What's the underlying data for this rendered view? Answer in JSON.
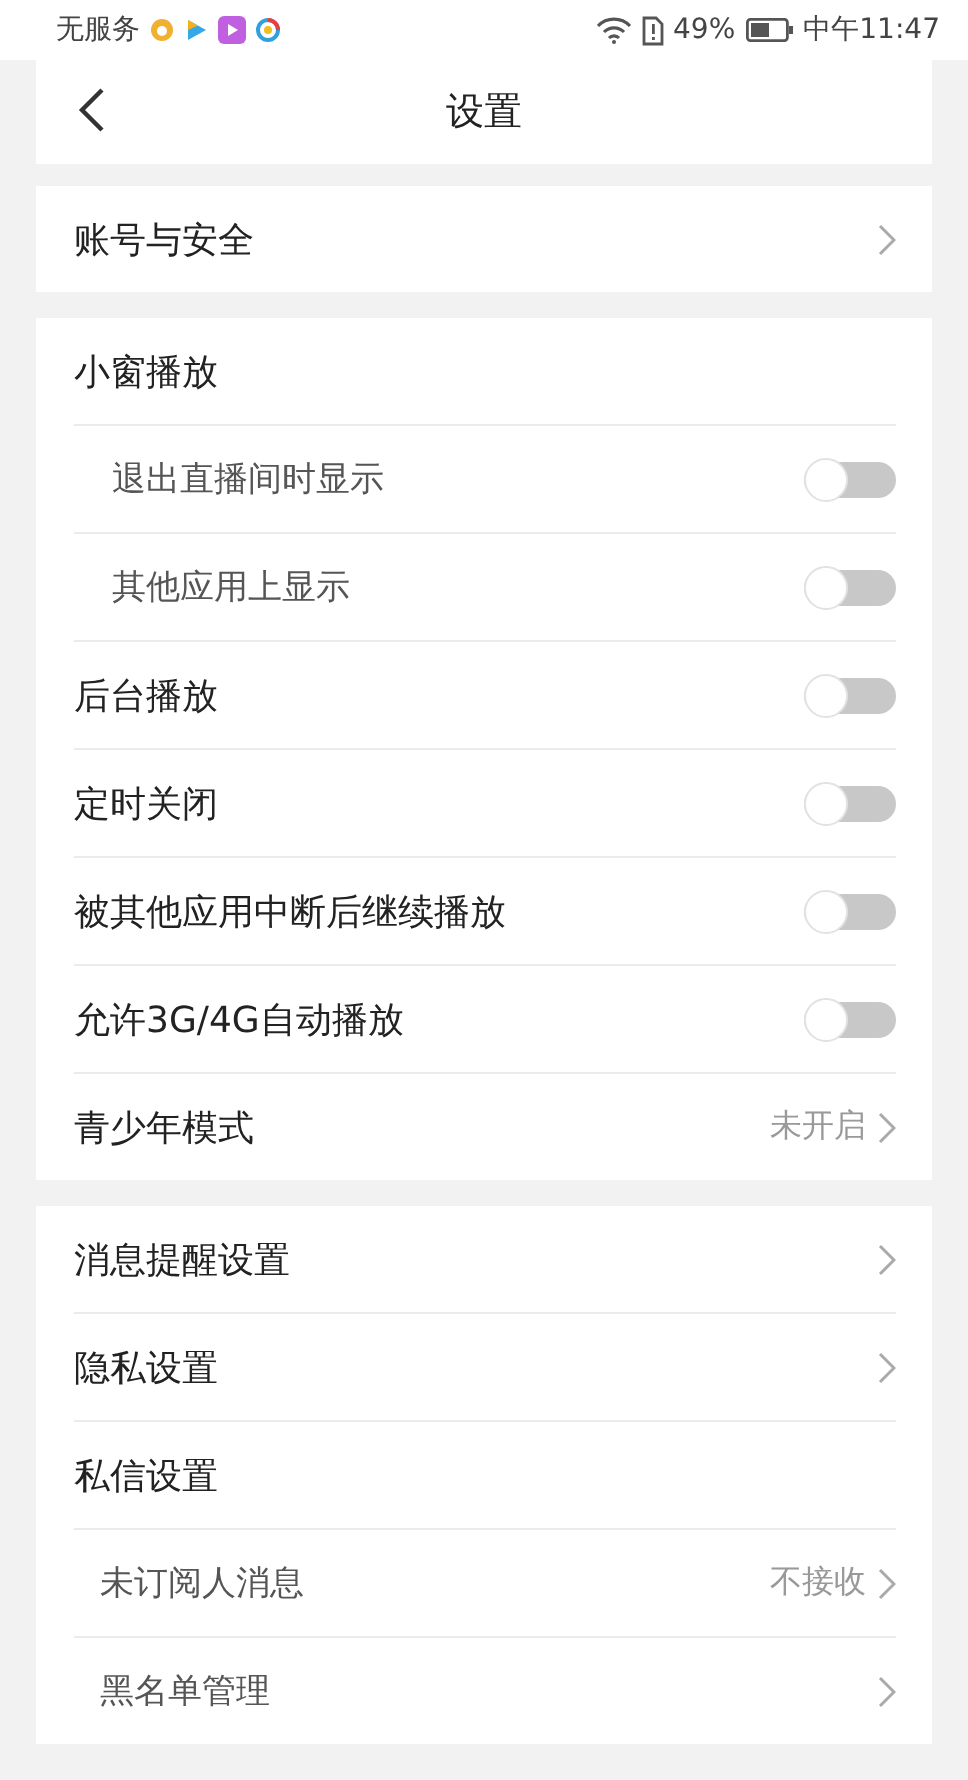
{
  "status_bar": {
    "carrier": "无服务",
    "battery": "49%",
    "time": "中午11:47"
  },
  "header": {
    "title": "设置"
  },
  "sections": [
    {
      "items": [
        {
          "kind": "link",
          "label": "账号与安全"
        }
      ]
    },
    {
      "items": [
        {
          "kind": "heading",
          "label": "小窗播放",
          "children": [
            {
              "kind": "toggle",
              "label": "退出直播间时显示",
              "on": false
            },
            {
              "kind": "toggle",
              "label": "其他应用上显示",
              "on": false
            }
          ]
        },
        {
          "kind": "toggle",
          "label": "后台播放",
          "on": false
        },
        {
          "kind": "toggle",
          "label": "定时关闭",
          "on": false
        },
        {
          "kind": "toggle",
          "label": "被其他应用中断后继续播放",
          "on": false
        },
        {
          "kind": "toggle",
          "label": "允许3G/4G自动播放",
          "on": false
        },
        {
          "kind": "link",
          "label": "青少年模式",
          "value": "未开启"
        }
      ]
    },
    {
      "items": [
        {
          "kind": "link",
          "label": "消息提醒设置"
        },
        {
          "kind": "link",
          "label": "隐私设置"
        },
        {
          "kind": "heading",
          "label": "私信设置",
          "children": [
            {
              "kind": "link",
              "label": "未订阅人消息",
              "value": "不接收"
            },
            {
              "kind": "link",
              "label": "黑名单管理"
            }
          ]
        }
      ]
    }
  ]
}
